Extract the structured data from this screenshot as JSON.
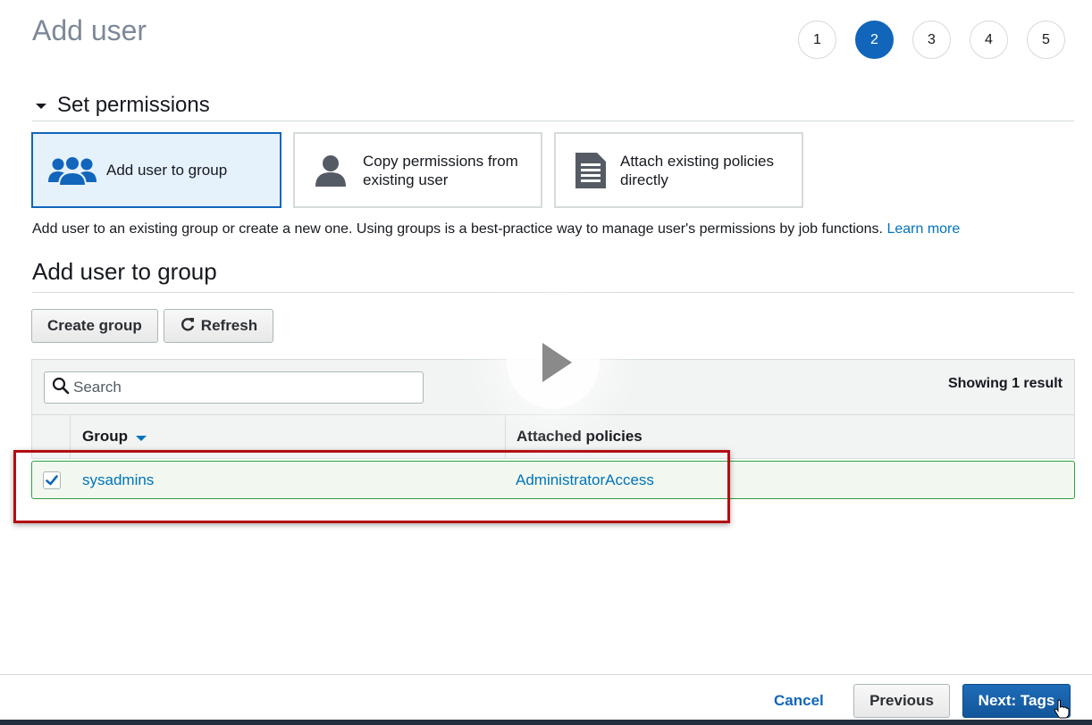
{
  "page": {
    "title": "Add user"
  },
  "steps": [
    {
      "label": "1",
      "active": false
    },
    {
      "label": "2",
      "active": true
    },
    {
      "label": "3",
      "active": false
    },
    {
      "label": "4",
      "active": false
    },
    {
      "label": "5",
      "active": false
    }
  ],
  "permissions": {
    "section_title": "Set permissions",
    "options": [
      {
        "label": "Add user to group",
        "icon": "users-group-icon",
        "selected": true
      },
      {
        "line1": "Copy permissions from",
        "line2": "existing user",
        "icon": "user-icon",
        "selected": false
      },
      {
        "line1": "Attach existing policies",
        "line2": "directly",
        "icon": "document-icon",
        "selected": false
      }
    ],
    "description": "Add user to an existing group or create a new one. Using groups is a best-practice way to manage user's permissions by job functions.",
    "learn_more": "Learn more"
  },
  "group_section": {
    "title": "Add user to group",
    "create_button": "Create group",
    "refresh_button": "Refresh",
    "search_placeholder": "Search",
    "result_count": "Showing 1 result",
    "columns": {
      "group": "Group",
      "policies": "Attached policies"
    },
    "rows": [
      {
        "checked": true,
        "group": "sysadmins",
        "policies": "AdministratorAccess"
      }
    ]
  },
  "footer": {
    "cancel": "Cancel",
    "previous": "Previous",
    "next": "Next: Tags"
  },
  "colors": {
    "primary": "#1166bb",
    "link": "#0073bb",
    "highlight": "#b30d12",
    "selected_row_border": "#2e9e3f"
  }
}
